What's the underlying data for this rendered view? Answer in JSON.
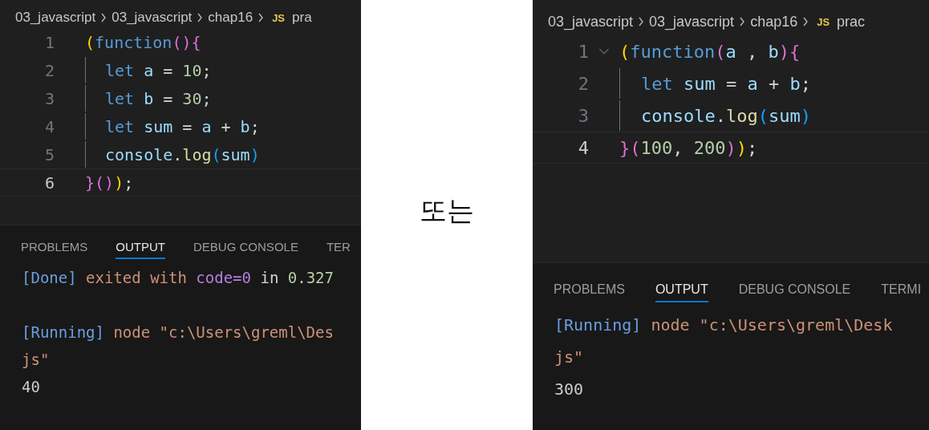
{
  "panels": [
    {
      "breadcrumb": [
        "03_javascript",
        "03_javascript",
        "chap16"
      ],
      "file_badge": "JS",
      "file_name": "pra",
      "code_lines": [
        {
          "number": "1",
          "current": false,
          "fold": false,
          "indented": false,
          "tokens": [
            {
              "kind": "bracket1",
              "text": "("
            },
            {
              "kind": "keyword",
              "text": "function"
            },
            {
              "kind": "bracket2",
              "text": "(){"
            }
          ]
        },
        {
          "number": "2",
          "current": false,
          "fold": false,
          "indented": true,
          "tokens": [
            {
              "kind": "keyword",
              "text": "let "
            },
            {
              "kind": "variable",
              "text": "a"
            },
            {
              "kind": "plain",
              "text": " = "
            },
            {
              "kind": "number",
              "text": "10"
            },
            {
              "kind": "plain",
              "text": ";"
            }
          ]
        },
        {
          "number": "3",
          "current": false,
          "fold": false,
          "indented": true,
          "tokens": [
            {
              "kind": "keyword",
              "text": "let "
            },
            {
              "kind": "variable",
              "text": "b"
            },
            {
              "kind": "plain",
              "text": " = "
            },
            {
              "kind": "number",
              "text": "30"
            },
            {
              "kind": "plain",
              "text": ";"
            }
          ]
        },
        {
          "number": "4",
          "current": false,
          "fold": false,
          "indented": true,
          "tokens": [
            {
              "kind": "keyword",
              "text": "let "
            },
            {
              "kind": "variable",
              "text": "sum"
            },
            {
              "kind": "plain",
              "text": " = "
            },
            {
              "kind": "variable",
              "text": "a"
            },
            {
              "kind": "plain",
              "text": " + "
            },
            {
              "kind": "variable",
              "text": "b"
            },
            {
              "kind": "plain",
              "text": ";"
            }
          ]
        },
        {
          "number": "5",
          "current": false,
          "fold": false,
          "indented": true,
          "tokens": [
            {
              "kind": "variable",
              "text": "console"
            },
            {
              "kind": "plain",
              "text": "."
            },
            {
              "kind": "call",
              "text": "log"
            },
            {
              "kind": "bracket3",
              "text": "("
            },
            {
              "kind": "variable",
              "text": "sum"
            },
            {
              "kind": "bracket3",
              "text": ")"
            }
          ]
        },
        {
          "number": "6",
          "current": true,
          "fold": false,
          "indented": false,
          "tokens": [
            {
              "kind": "bracket2",
              "text": "}()"
            },
            {
              "kind": "bracket1",
              "text": ")"
            },
            {
              "kind": "plain",
              "text": ";"
            }
          ]
        }
      ],
      "panel_tabs": [
        {
          "label": "PROBLEMS",
          "selected": false
        },
        {
          "label": "OUTPUT",
          "selected": true
        },
        {
          "label": "DEBUG CONSOLE",
          "selected": false
        },
        {
          "label": "TER",
          "selected": false
        }
      ],
      "output_lines": [
        {
          "tokens": [
            {
              "kind": "tag",
              "text": "[Done]"
            },
            {
              "kind": "string",
              "text": " exited with "
            },
            {
              "kind": "code",
              "text": "code=0"
            },
            {
              "kind": "plain",
              "text": " in "
            },
            {
              "kind": "number",
              "text": "0.327"
            }
          ]
        },
        {
          "tokens": [
            {
              "kind": "tag",
              "text": "[Running]"
            },
            {
              "kind": "string",
              "text": " node \"c:\\Users\\greml\\Des"
            }
          ]
        },
        {
          "tokens": [
            {
              "kind": "string",
              "text": "js\""
            }
          ]
        },
        {
          "tokens": [
            {
              "kind": "result",
              "text": "40"
            }
          ]
        }
      ]
    },
    {
      "breadcrumb": [
        "03_javascript",
        "03_javascript",
        "chap16"
      ],
      "file_badge": "JS",
      "file_name": "prac",
      "code_lines": [
        {
          "number": "1",
          "current": false,
          "fold": true,
          "indented": false,
          "tokens": [
            {
              "kind": "bracket1",
              "text": "("
            },
            {
              "kind": "keyword",
              "text": "function"
            },
            {
              "kind": "bracket2",
              "text": "("
            },
            {
              "kind": "variable",
              "text": "a"
            },
            {
              "kind": "plain",
              "text": " , "
            },
            {
              "kind": "variable",
              "text": "b"
            },
            {
              "kind": "bracket2",
              "text": "){"
            }
          ]
        },
        {
          "number": "2",
          "current": false,
          "fold": false,
          "indented": true,
          "tokens": [
            {
              "kind": "keyword",
              "text": "let "
            },
            {
              "kind": "variable",
              "text": "sum"
            },
            {
              "kind": "plain",
              "text": " = "
            },
            {
              "kind": "variable",
              "text": "a"
            },
            {
              "kind": "plain",
              "text": " + "
            },
            {
              "kind": "variable",
              "text": "b"
            },
            {
              "kind": "plain",
              "text": ";"
            }
          ]
        },
        {
          "number": "3",
          "current": false,
          "fold": false,
          "indented": true,
          "tokens": [
            {
              "kind": "variable",
              "text": "console"
            },
            {
              "kind": "plain",
              "text": "."
            },
            {
              "kind": "call",
              "text": "log"
            },
            {
              "kind": "bracket3",
              "text": "("
            },
            {
              "kind": "variable",
              "text": "sum"
            },
            {
              "kind": "bracket3",
              "text": ")"
            }
          ]
        },
        {
          "number": "4",
          "current": true,
          "fold": false,
          "indented": false,
          "tokens": [
            {
              "kind": "bracket2",
              "text": "}("
            },
            {
              "kind": "number",
              "text": "100"
            },
            {
              "kind": "plain",
              "text": ", "
            },
            {
              "kind": "number",
              "text": "200"
            },
            {
              "kind": "bracket2",
              "text": ")"
            },
            {
              "kind": "bracket1",
              "text": ")"
            },
            {
              "kind": "plain",
              "text": ";"
            }
          ]
        }
      ],
      "panel_tabs": [
        {
          "label": "PROBLEMS",
          "selected": false
        },
        {
          "label": "OUTPUT",
          "selected": true
        },
        {
          "label": "DEBUG CONSOLE",
          "selected": false
        },
        {
          "label": "TERMI",
          "selected": false
        }
      ],
      "output_lines": [
        {
          "tokens": [
            {
              "kind": "tag",
              "text": "[Running]"
            },
            {
              "kind": "string",
              "text": " node \"c:\\Users\\greml\\Desk"
            }
          ]
        },
        {
          "tokens": [
            {
              "kind": "string",
              "text": "js\""
            }
          ]
        },
        {
          "tokens": [
            {
              "kind": "result",
              "text": "300"
            }
          ]
        }
      ]
    }
  ],
  "separator_text": "또는"
}
